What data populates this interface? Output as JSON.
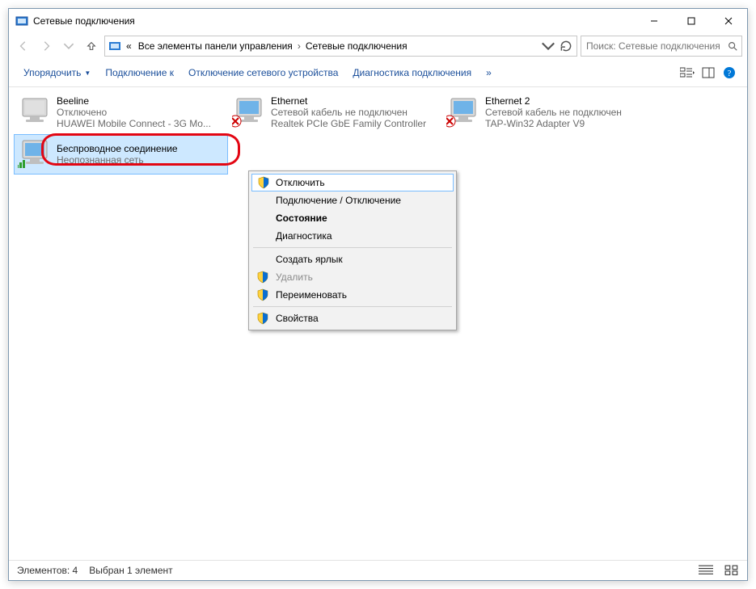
{
  "window": {
    "title": "Сетевые подключения"
  },
  "breadcrumbs": {
    "prefix": "«",
    "part1": "Все элементы панели управления",
    "part2": "Сетевые подключения"
  },
  "search": {
    "placeholder": "Поиск: Сетевые подключения"
  },
  "toolbar": {
    "organize": "Упорядочить",
    "connect": "Подключение к",
    "disable": "Отключение сетевого устройства",
    "diagnose": "Диагностика подключения",
    "more": "»"
  },
  "connections": [
    {
      "name": "Beeline",
      "status": "Отключено",
      "device": "HUAWEI Mobile Connect - 3G Mo...",
      "x": false,
      "bars": false
    },
    {
      "name": "Ethernet",
      "status": "Сетевой кабель не подключен",
      "device": "Realtek PCIe GbE Family Controller",
      "x": true,
      "bars": false
    },
    {
      "name": "Ethernet 2",
      "status": "Сетевой кабель не подключен",
      "device": "TAP-Win32 Adapter V9",
      "x": true,
      "bars": false
    },
    {
      "name": "Беспроводное соединение",
      "status": "Неопознанная сеть",
      "device": "",
      "x": false,
      "bars": true,
      "selected": true
    }
  ],
  "context_menu": {
    "items": [
      {
        "label": "Отключить",
        "shield": true,
        "hover": true
      },
      {
        "label": "Подключение / Отключение"
      },
      {
        "label": "Состояние",
        "bold": true
      },
      {
        "label": "Диагностика"
      },
      {
        "sep": true
      },
      {
        "label": "Создать ярлык"
      },
      {
        "label": "Удалить",
        "shield": true,
        "disabled": true
      },
      {
        "label": "Переименовать",
        "shield": true
      },
      {
        "sep": true
      },
      {
        "label": "Свойства",
        "shield": true
      }
    ]
  },
  "statusbar": {
    "count": "Элементов: 4",
    "selection": "Выбран 1 элемент"
  }
}
